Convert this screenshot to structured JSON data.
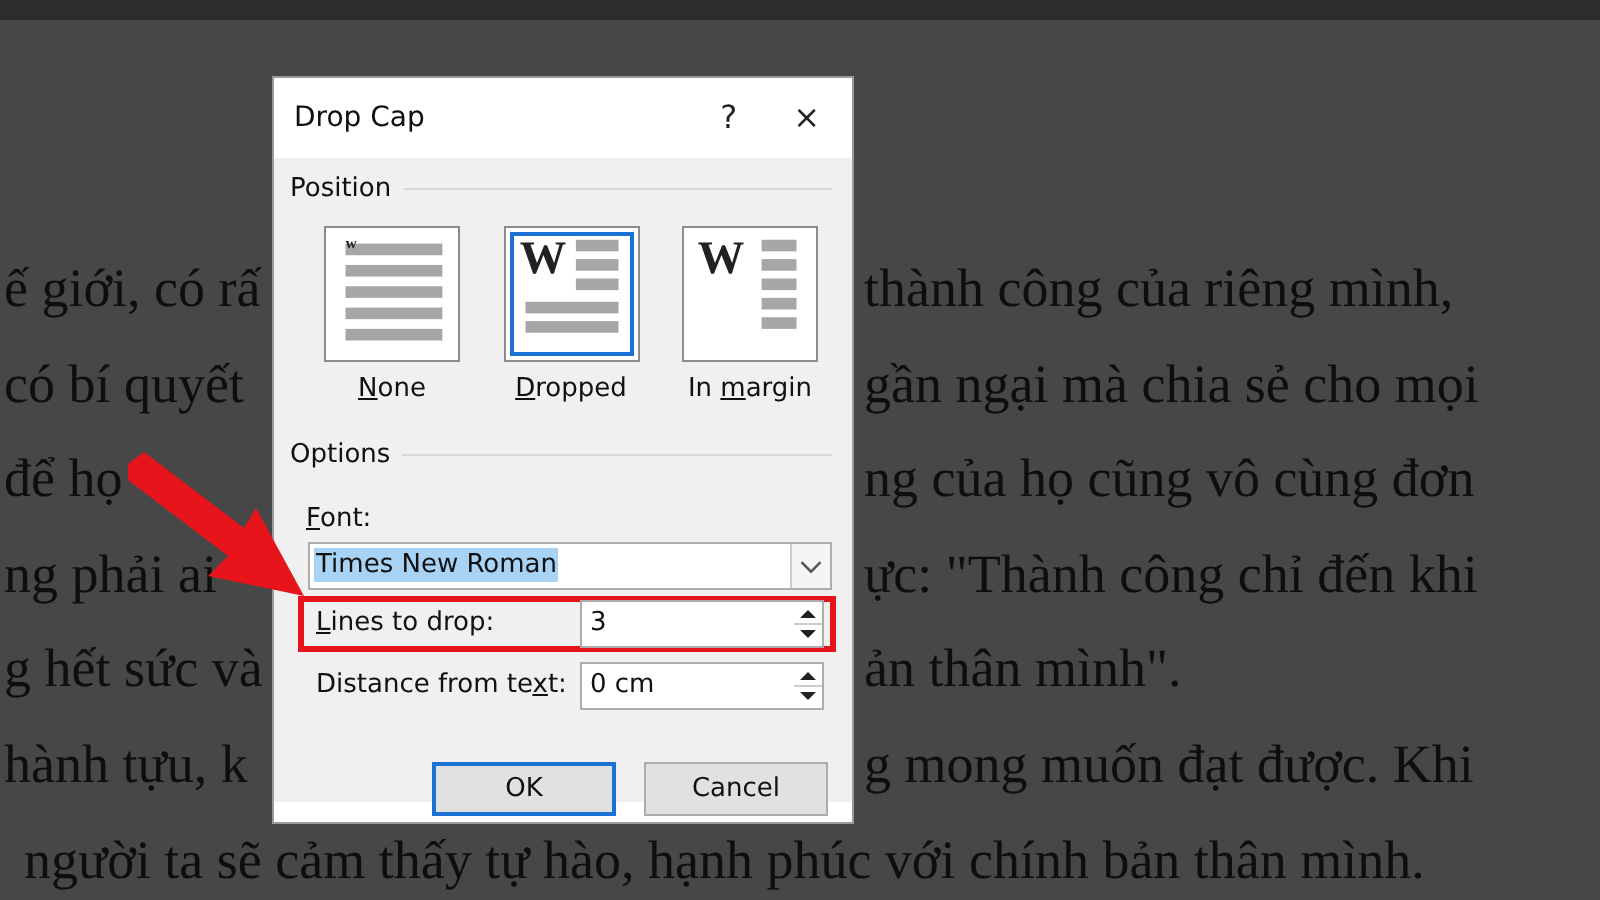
{
  "document": {
    "lines": [
      {
        "left": "ế giới, có rấ",
        "right": "thành công của riêng mình,"
      },
      {
        "left": "có bí quyết",
        "right": "gần ngại mà chia sẻ cho mọi"
      },
      {
        "left": "để họ",
        "right": "ng của họ cũng vô cùng đơn"
      },
      {
        "left": "ng phải ai",
        "right": "ực: \"Thành công chỉ đến khi"
      },
      {
        "left": "g hết sức và",
        "right": "ản thân mình\"."
      },
      {
        "left": "hành tựu, k",
        "right": "g mong muốn đạt được. Khi"
      },
      {
        "full": "người ta sẽ cảm thấy tự hào, hạnh phúc với chính bản thân mình."
      }
    ]
  },
  "dialog": {
    "title": "Drop Cap",
    "help_button": "?",
    "close_button": "×",
    "position": {
      "label": "Position",
      "options": [
        {
          "kind": "none",
          "glyph": "w",
          "label": {
            "key": "N",
            "post": "one"
          },
          "selected": false
        },
        {
          "kind": "dropped",
          "glyph": "W",
          "label": {
            "key": "D",
            "post": "ropped"
          },
          "selected": true
        },
        {
          "kind": "margin",
          "glyph": "W",
          "label": {
            "pre": "In ",
            "key": "m",
            "post": "argin"
          },
          "selected": false
        }
      ]
    },
    "options": {
      "label": "Options",
      "font": {
        "label": {
          "key": "F",
          "post": "ont:"
        },
        "value": "Times New Roman",
        "text_selected": true
      },
      "fields": [
        {
          "label": {
            "key": "L",
            "post": "ines to drop:"
          },
          "value": "3",
          "highlighted": true
        },
        {
          "label": {
            "pre": "Distance from te",
            "key": "x",
            "post": "t:"
          },
          "value": "0 cm",
          "highlighted": false
        }
      ]
    },
    "buttons": [
      {
        "label": "OK",
        "default": true
      },
      {
        "label": "Cancel",
        "default": false
      }
    ]
  }
}
